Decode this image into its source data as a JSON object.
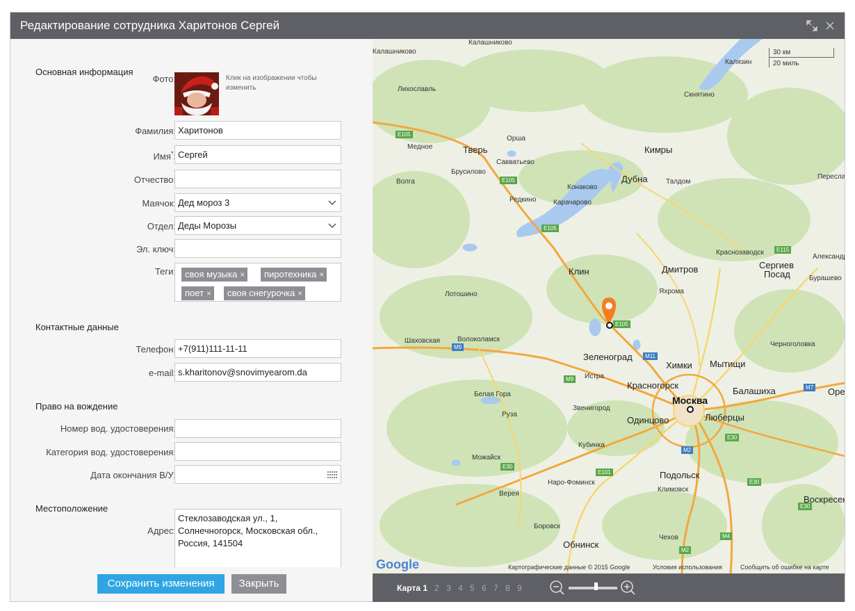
{
  "dialog": {
    "title": "Редактирование сотрудника Харитонов Сергей",
    "icons": [
      "expand-icon",
      "close-icon"
    ]
  },
  "sections": {
    "basic": "Основная информация",
    "contacts": "Контактные данные",
    "driving": "Право на вождение",
    "location": "Местоположение"
  },
  "form": {
    "photo_label": "Фото:",
    "photo_hint": "Клик на изображении чтобы изменить",
    "lastname_label": "Фамилия:",
    "lastname_value": "Харитонов",
    "firstname_label": "Имя",
    "firstname_required": "*",
    "firstname_colon": ":",
    "firstname_value": "Сергей",
    "middlename_label": "Отчество:",
    "middlename_value": "",
    "beacon_label": "Маячок:",
    "beacon_value": "Дед мороз 3",
    "department_label": "Отдел:",
    "department_value": "Деды Морозы",
    "ekey_label": "Эл. ключ:",
    "ekey_value": "",
    "tags_label": "Теги:",
    "tags": [
      "своя музыка",
      "пиротехника",
      "поет",
      "своя снегурочка"
    ],
    "tag_remove": "×",
    "phone_label": "Телефон:",
    "phone_value": "+7(911)111-11-11",
    "email_label": "e-mail:",
    "email_value": "s.kharitonov@snovimyearom.da",
    "license_number_label": "Номер вод. удостоверения:",
    "license_number_value": "",
    "license_category_label": "Категория вод. удостоверения:",
    "license_category_value": "",
    "license_expiry_label": "Дата окончания В/У:",
    "license_expiry_value": "",
    "address_label": "Адрес:",
    "address_lines": [
      "Стеклозаводская ул., 1,",
      "Солнечногорск, Московская обл.,",
      "Россия, 141504"
    ]
  },
  "buttons": {
    "save": "Сохранить изменения",
    "close": "Закрыть"
  },
  "map": {
    "colors": {
      "land": "#eef0e6",
      "forest": "#cfe3b7",
      "water": "#a9c9ef",
      "highway": "#f3a73c",
      "road": "#f6d66e",
      "marker": "#f57c1f"
    },
    "scale_km": "30 км",
    "scale_mi": "20 миль",
    "google_logo": "Google",
    "attribution": "Картографические данные © 2015 Google",
    "terms": "Условия использования",
    "report": "Сообщить об ошибке на карте",
    "labels": {
      "l1": "Калязин",
      "l2": "Скнятино",
      "l3": "Кимры",
      "l4": "Тверь",
      "l5": "Медное",
      "l6": "Орша",
      "l7": "Савватьево",
      "l8": "Бурашево",
      "l9": "Волга",
      "l10": "Редкино",
      "l11": "Конаково",
      "l12": "Карачарово",
      "l13": "Дубна",
      "l14": "Талдом",
      "l15": "Пересла",
      "l16": "Лихославль",
      "l17": "Клин",
      "l18": "Дмитров",
      "l19": "Краснозаводск",
      "l20": "Александр",
      "l21": "Сергиев",
      "l22": "Посад",
      "l23": "Лотошино",
      "l24": "Яхрома",
      "l25": "Шаховская",
      "l26": "Волоколамск",
      "l27": "Зеленоград",
      "l28": "Химки",
      "l29": "Мытищи",
      "l30": "Истра",
      "l31": "Красногорск",
      "l32": "Москва",
      "l33": "Балашиха",
      "l34": "Одинцово",
      "l35": "Люберцы",
      "l36": "Белая Гора",
      "l37": "Звенигород",
      "l38": "Руза",
      "l39": "Кубинка",
      "l40": "Можайск",
      "l41": "Наро-Фоминск",
      "l42": "Подольск",
      "l43": "Климовск",
      "l44": "Верея",
      "l45": "Боровск",
      "l46": "Обнинск",
      "l47": "Чехов",
      "l48": "Воскресен",
      "l49": "Черноголовка",
      "l50": "Орех",
      "l51": "Бурашево",
      "l52": "Брусилово",
      "l53": "Калашниково",
      "l54": "Пересла"
    },
    "shields": {
      "s1": "E105",
      "s2": "E105",
      "s3": "E105",
      "s4": "E105",
      "s5": "M9",
      "s6": "M9",
      "s7": "M11",
      "s8": "E115",
      "s9": "M7",
      "s10": "E30",
      "s11": "E30",
      "s12": "E101",
      "s13": "M2",
      "s14": "E30",
      "s15": "M2",
      "s16": "M4",
      "s17": "E30"
    }
  },
  "map_pages": {
    "active": "Карта 1",
    "others": [
      "2",
      "3",
      "4",
      "5",
      "6",
      "7",
      "8",
      "9"
    ]
  },
  "zoom": {
    "level": 0.55,
    "icons": [
      "zoom-out-icon",
      "zoom-in-icon"
    ]
  }
}
